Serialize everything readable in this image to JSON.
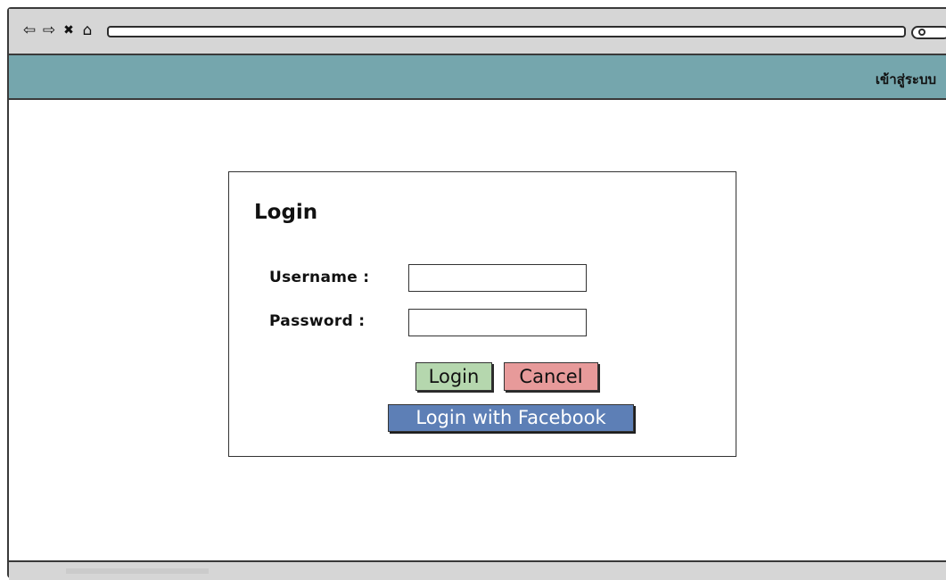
{
  "browser": {
    "nav_icons": [
      "back-icon",
      "forward-icon",
      "close-icon",
      "home-icon"
    ],
    "nav_glyphs": [
      "⇦",
      "⇨",
      "✖",
      "⌂"
    ],
    "url": ""
  },
  "header": {
    "link_label": "เข้าสู่ระบบ",
    "background": "#75a6ad"
  },
  "login": {
    "title": "Login",
    "username_label": "Username :",
    "username_value": "",
    "password_label": "Password :",
    "password_value": "",
    "login_button": "Login",
    "cancel_button": "Cancel",
    "facebook_button": "Login with Facebook"
  },
  "colors": {
    "login_button": "#b5d7ae",
    "cancel_button": "#e79a9a",
    "facebook_button": "#5d7fb6"
  }
}
